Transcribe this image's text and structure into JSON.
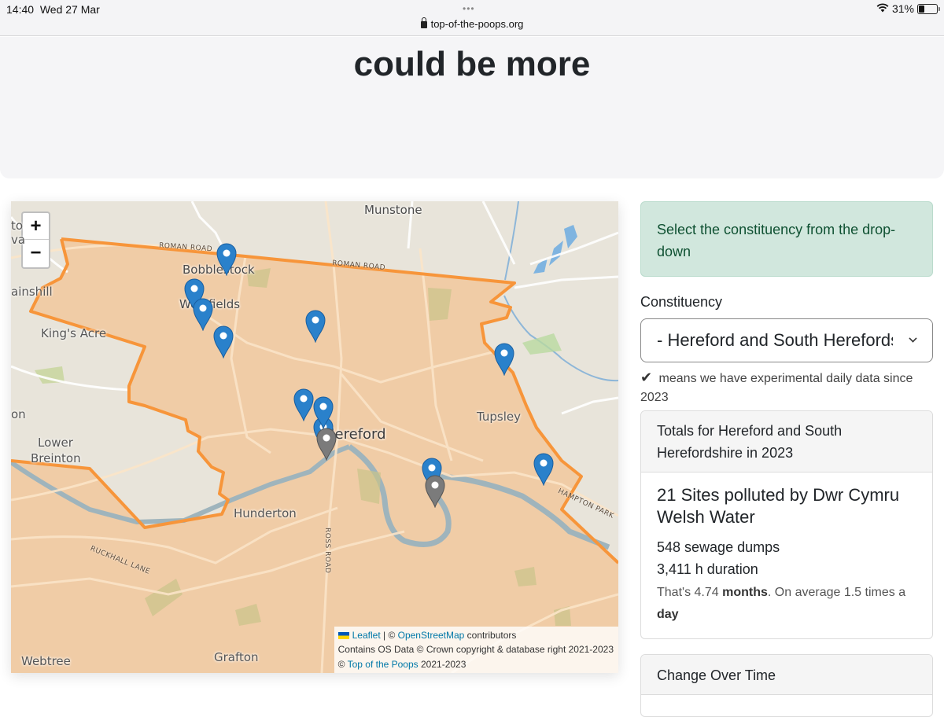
{
  "statusbar": {
    "time": "14:40",
    "date": "Wed 27 Mar",
    "url": "top-of-the-poops.org",
    "battery": "31%",
    "battery_level": 0.31
  },
  "hero": {
    "title": "could be more"
  },
  "map": {
    "zoom_in": "+",
    "zoom_out": "−",
    "places": {
      "munstone": "Munstone",
      "bobblestock": "Bobblestock",
      "westfields": "Westfields",
      "kings_acre": "King's Acre",
      "hereford": "Hereford",
      "tupsley": "Tupsley",
      "lower": "Lower",
      "breinton": "Breinton",
      "hunderton": "Hunderton",
      "webtree": "Webtree",
      "grafton": "Grafton",
      "ainshill": "ainshill",
      "edge_top": "to",
      "edge_top2": "va",
      "edge_left": "on"
    },
    "roads": {
      "roman_road_1": "ROMAN ROAD",
      "roman_road_2": "ROMAN ROAD",
      "ross_road": "ROSS ROAD",
      "ruckhall_lane": "RUCKHALL LANE",
      "hampton_park": "HAMPTON PARK"
    },
    "markers": [
      {
        "color": "blue"
      },
      {
        "color": "blue"
      },
      {
        "color": "blue"
      },
      {
        "color": "blue"
      },
      {
        "color": "blue"
      },
      {
        "color": "blue"
      },
      {
        "color": "blue"
      },
      {
        "color": "grey"
      },
      {
        "color": "blue"
      },
      {
        "color": "blue"
      },
      {
        "color": "blue"
      },
      {
        "color": "grey"
      },
      {
        "color": "blue"
      }
    ],
    "attribution": {
      "leaflet": "Leaflet",
      "sep": " | © ",
      "osm": "OpenStreetMap",
      "contributors": " contributors",
      "os_data": "Contains OS Data © Crown copyright & database right 2021-2023",
      "copy": "© ",
      "top_poops": "Top of the Poops",
      "years": " 2021-2023"
    },
    "colors": {
      "boundary": "#f7953a",
      "fill": "#f2c79a",
      "marker_blue": "#2a81cb",
      "marker_grey": "#7b7b7b"
    }
  },
  "sidebar": {
    "alert": "Select the constituency from the drop-down",
    "constituency_label": "Constituency",
    "constituency_value": "- Hereford and South Herefordshire",
    "hint_check": "✔",
    "hint_text": "means we have experimental daily data since 2023",
    "totals": {
      "header": "Totals for Hereford and South Herefordshire in 2023",
      "title": "21 Sites polluted by Dwr Cymru Welsh Water",
      "dumps": "548 sewage dumps",
      "duration": "3,411 h duration",
      "note_pre": "That's 4.74 ",
      "note_bold1": "months",
      "note_mid": ". On average 1.5 times a ",
      "note_bold2": "day"
    },
    "change_header": "Change Over Time"
  }
}
